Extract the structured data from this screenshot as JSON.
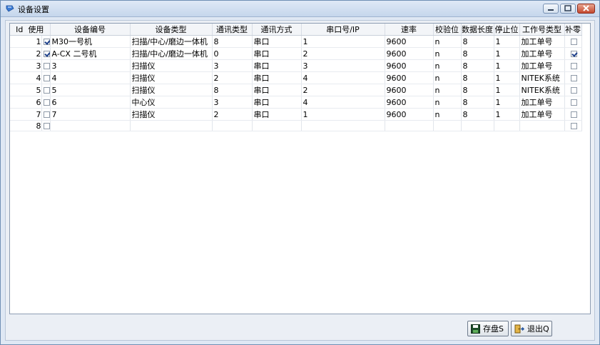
{
  "window": {
    "title": "设备设置"
  },
  "grid": {
    "headers": {
      "id": "Id",
      "use": "使用",
      "code": "设备编号",
      "type": "设备类型",
      "comm_type": "通讯类型",
      "comm_mode": "通讯方式",
      "port": "串口号/IP",
      "baud": "速率",
      "parity": "校验位",
      "data_len": "数据长度",
      "stop": "停止位",
      "job_type": "工作号类型",
      "pad": "补零"
    },
    "rows": [
      {
        "id": "1",
        "use": true,
        "code": "M30一号机",
        "type": "扫描/中心/磨边一体机",
        "comm_type": "8",
        "comm_mode": "串口",
        "port": "1",
        "baud": "9600",
        "parity": "n",
        "data_len": "8",
        "stop": "1",
        "job_type": "加工单号",
        "pad": false
      },
      {
        "id": "2",
        "use": true,
        "code": "A-CX 二号机",
        "type": "扫描/中心/磨边一体机",
        "comm_type": "0",
        "comm_mode": "串口",
        "port": "2",
        "baud": "9600",
        "parity": "n",
        "data_len": "8",
        "stop": "1",
        "job_type": "加工单号",
        "pad": true
      },
      {
        "id": "3",
        "use": false,
        "code": "3",
        "type": "扫描仪",
        "comm_type": "3",
        "comm_mode": "串口",
        "port": "3",
        "baud": "9600",
        "parity": "n",
        "data_len": "8",
        "stop": "1",
        "job_type": "加工单号",
        "pad": false
      },
      {
        "id": "4",
        "use": false,
        "code": "4",
        "type": "扫描仪",
        "comm_type": "2",
        "comm_mode": "串口",
        "port": "4",
        "baud": "9600",
        "parity": "n",
        "data_len": "8",
        "stop": "1",
        "job_type": "NITEK系统",
        "pad": false
      },
      {
        "id": "5",
        "use": false,
        "code": "5",
        "type": "扫描仪",
        "comm_type": "8",
        "comm_mode": "串口",
        "port": "2",
        "baud": "9600",
        "parity": "n",
        "data_len": "8",
        "stop": "1",
        "job_type": "NITEK系统",
        "pad": false
      },
      {
        "id": "6",
        "use": false,
        "code": "6",
        "type": "中心仪",
        "comm_type": "3",
        "comm_mode": "串口",
        "port": "4",
        "baud": "9600",
        "parity": "n",
        "data_len": "8",
        "stop": "1",
        "job_type": "加工单号",
        "pad": false
      },
      {
        "id": "7",
        "use": false,
        "code": "7",
        "type": "扫描仪",
        "comm_type": "2",
        "comm_mode": "串口",
        "port": "1",
        "baud": "9600",
        "parity": "n",
        "data_len": "8",
        "stop": "1",
        "job_type": "加工单号",
        "pad": false
      },
      {
        "id": "8",
        "use": false,
        "code": "",
        "type": "",
        "comm_type": "",
        "comm_mode": "",
        "port": "",
        "baud": "",
        "parity": "",
        "data_len": "",
        "stop": "",
        "job_type": "",
        "pad": false
      }
    ]
  },
  "buttons": {
    "save": "存盘S",
    "exit": "退出Q"
  },
  "icons": {
    "title": "window-app-icon",
    "save": "floppy-disk-icon",
    "exit": "exit-door-icon"
  },
  "colors": {
    "titlebar": "#c5d6ec",
    "close": "#c4482f",
    "check": "#1c3f8a"
  }
}
